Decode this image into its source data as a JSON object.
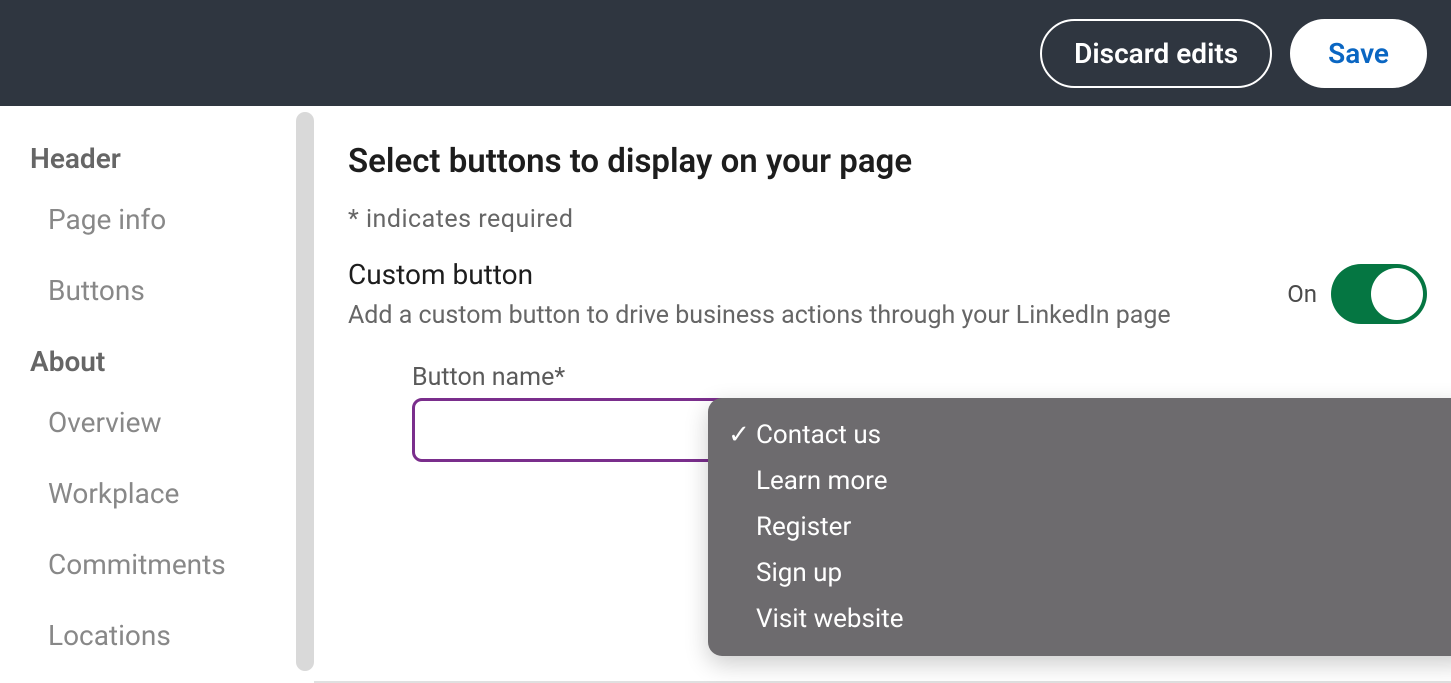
{
  "header": {
    "discard_label": "Discard edits",
    "save_label": "Save"
  },
  "sidebar": {
    "groups": [
      {
        "label": "Header",
        "items": [
          {
            "label": "Page info"
          },
          {
            "label": "Buttons"
          }
        ]
      },
      {
        "label": "About",
        "items": [
          {
            "label": "Overview"
          },
          {
            "label": "Workplace"
          },
          {
            "label": "Commitments"
          },
          {
            "label": "Locations"
          }
        ]
      }
    ]
  },
  "main": {
    "title": "Select buttons to display on your page",
    "required_note": "*  indicates required",
    "custom_button": {
      "title": "Custom button",
      "description": "Add a custom button to drive business actions through your LinkedIn page",
      "toggle_state": "On",
      "toggle_on": true
    },
    "form": {
      "button_name_label": "Button name*",
      "button_name_options": [
        {
          "label": "Contact us",
          "selected": true
        },
        {
          "label": "Learn more",
          "selected": false
        },
        {
          "label": "Register",
          "selected": false
        },
        {
          "label": "Sign up",
          "selected": false
        },
        {
          "label": "Visit website",
          "selected": false
        }
      ]
    }
  }
}
